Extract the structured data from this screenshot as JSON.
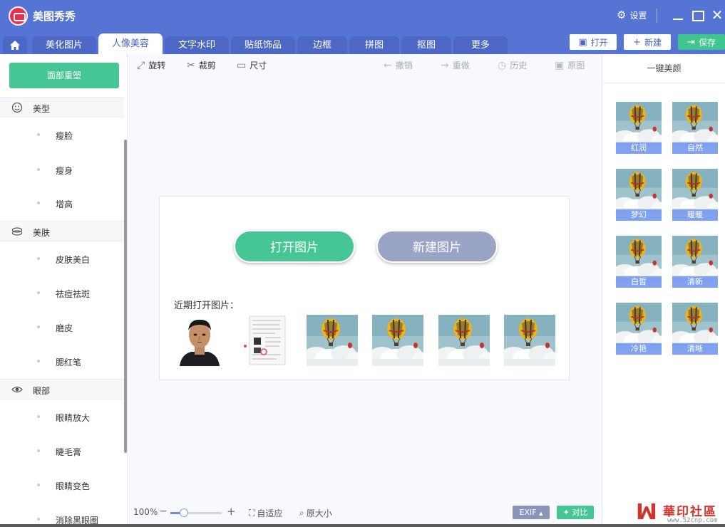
{
  "app": {
    "title": "美图秀秀",
    "settings_label": "设置"
  },
  "tabs": [
    "美化图片",
    "人像美容",
    "文字水印",
    "贴纸饰品",
    "边框",
    "拼图",
    "抠图",
    "更多"
  ],
  "active_tab": "人像美容",
  "top_buttons": {
    "open": "打开",
    "new": "新建",
    "save": "保存"
  },
  "sidebar": {
    "primary_button": "面部重塑",
    "sections": [
      {
        "label": "美型",
        "items": [
          "瘦脸",
          "瘦身",
          "增高"
        ]
      },
      {
        "label": "美肤",
        "items": [
          "皮肤美白",
          "祛痘祛斑",
          "磨皮",
          "腮红笔"
        ]
      },
      {
        "label": "眼部",
        "items": [
          "眼睛放大",
          "睫毛膏",
          "眼睛变色",
          "消除黑眼圈"
        ]
      }
    ]
  },
  "toolbar": {
    "rotate": "旋转",
    "crop": "裁剪",
    "size": "尺寸",
    "undo": "撤销",
    "redo": "重做",
    "history": "历史",
    "original": "原图"
  },
  "canvas": {
    "open_image": "打开图片",
    "new_image": "新建图片",
    "recent_label": "近期打开图片："
  },
  "statusbar": {
    "zoom": "100%",
    "zoom_level": 0.27,
    "fit": "自适应",
    "actual_size": "原大小",
    "exif": "EXIF",
    "compare": "对比"
  },
  "right_panel": {
    "title": "一键美颜",
    "presets": [
      "红润",
      "自然",
      "梦幻",
      "暖暖",
      "白皙",
      "清新",
      "冷艳",
      "清晰"
    ]
  },
  "watermark": {
    "text": "華印社區",
    "url": "www.52cnp.com"
  },
  "colors": {
    "primary": "#5574d3",
    "accent_green": "#45c694",
    "muted_blue": "#9aa5c5",
    "preset_label": "#6c92ee"
  }
}
